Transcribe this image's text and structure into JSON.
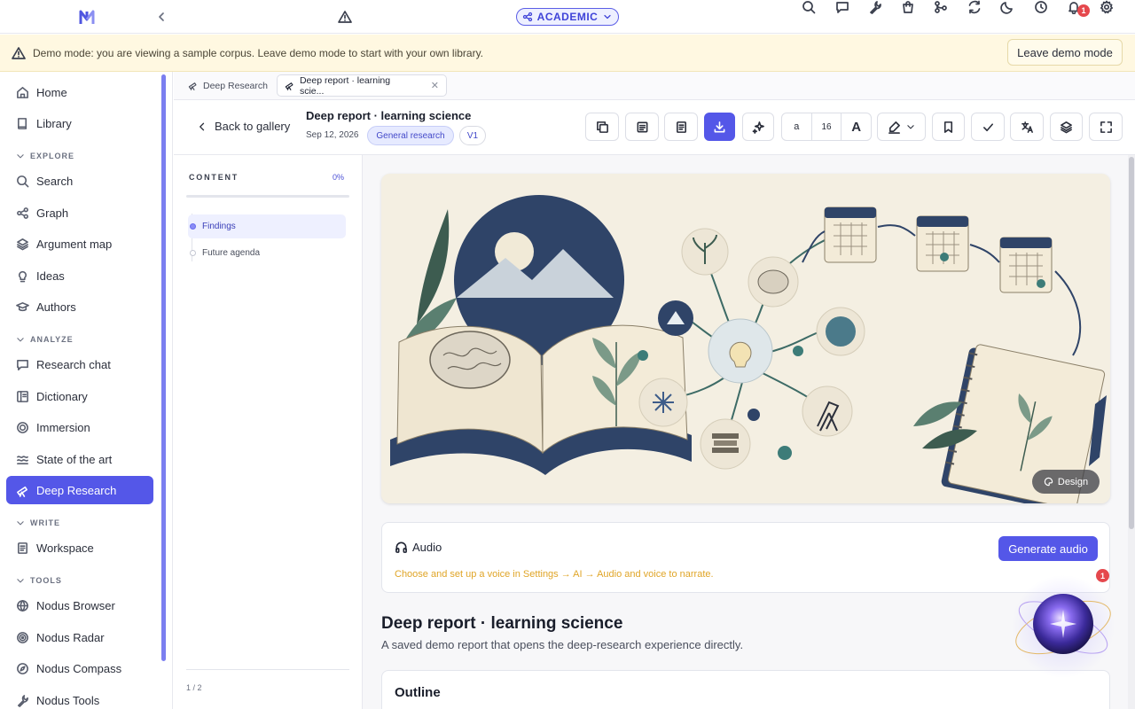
{
  "topbar": {
    "mode_label": "ACADEMIC",
    "notification_count": "1"
  },
  "banner": {
    "text": "Demo mode: you are viewing a sample corpus. Leave demo mode to start with your own library.",
    "leave_label": "Leave demo mode"
  },
  "sidebar": {
    "home": "Home",
    "library": "Library",
    "sections": {
      "explore": "EXPLORE",
      "analyze": "ANALYZE",
      "write": "WRITE",
      "tools": "TOOLS"
    },
    "explore": [
      "Search",
      "Graph",
      "Argument map",
      "Ideas",
      "Authors"
    ],
    "analyze": [
      "Research chat",
      "Dictionary",
      "Immersion",
      "State of the art",
      "Deep Research"
    ],
    "write": [
      "Workspace"
    ],
    "tools": [
      "Nodus Browser",
      "Nodus Radar",
      "Nodus Compass",
      "Nodus Tools"
    ],
    "active": "Deep Research"
  },
  "tabs": [
    {
      "label": "Deep Research",
      "active": false
    },
    {
      "label": "Deep report · learning scie...",
      "active": true
    }
  ],
  "report": {
    "back_label": "Back to gallery",
    "title": "Deep report · learning science",
    "date": "Sep 12, 2026",
    "category": "General research",
    "version": "V1",
    "font_small": "a",
    "font_size": "16",
    "font_large": "A"
  },
  "outline": {
    "heading": "CONTENT",
    "progress": "0%",
    "items": [
      "Findings",
      "Future agenda"
    ],
    "active": "Findings",
    "pager": "1 / 2"
  },
  "content": {
    "design_label": "Design",
    "audio_title": "Audio",
    "audio_hint": "Choose and set up a voice in Settings → AI → Audio and voice to narrate.",
    "generate_audio": "Generate audio",
    "report_title": "Deep report · learning science",
    "report_subtitle": "A saved demo report that opens the deep-research experience directly.",
    "outline_heading": "Outline",
    "assistant_badge": "1"
  },
  "colors": {
    "accent": "#5457e8",
    "banner_bg": "#fff8e1",
    "warning_text": "#e0a527",
    "badge": "#e5484d"
  }
}
